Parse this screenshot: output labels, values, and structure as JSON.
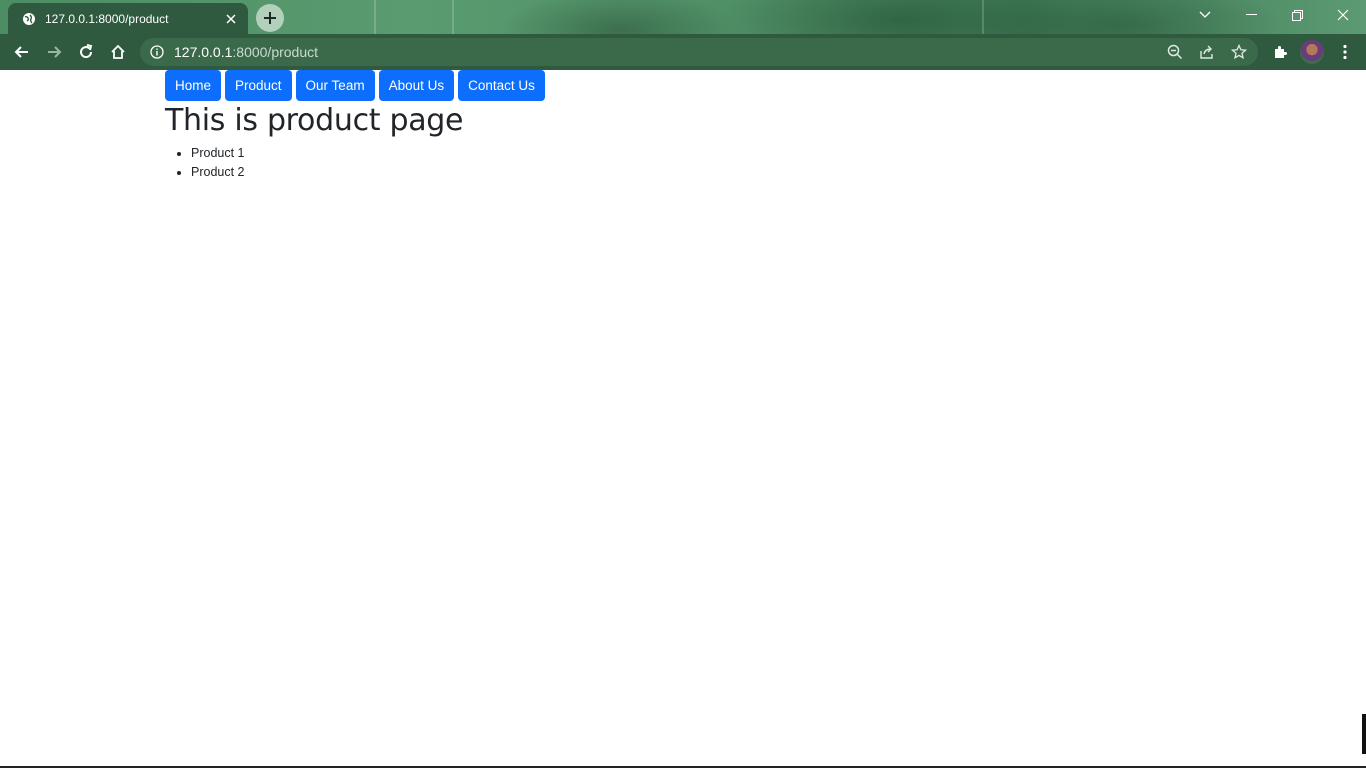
{
  "browser": {
    "tab": {
      "title": "127.0.0.1:8000/product",
      "favicon": "globe-icon",
      "close_icon": "close-icon"
    },
    "new_tab_icon": "plus-icon",
    "window_controls": [
      "tab-search-icon",
      "minimize-icon",
      "restore-icon",
      "close-icon"
    ],
    "toolbar": {
      "back_icon": "back-arrow-icon",
      "forward_icon": "forward-arrow-icon",
      "reload_icon": "reload-icon",
      "home_icon": "home-icon",
      "address": {
        "host": "127.0.0.1",
        "path": ":8000/product",
        "info_icon": "info-icon"
      },
      "zoom_icon": "zoom-out-icon",
      "share_icon": "share-icon",
      "bookmark_icon": "star-icon",
      "extensions_icon": "puzzle-icon",
      "profile_icon": "avatar",
      "menu_icon": "kebab-menu-icon"
    }
  },
  "nav": {
    "items": [
      {
        "label": "Home"
      },
      {
        "label": "Product"
      },
      {
        "label": "Our Team"
      },
      {
        "label": "About Us"
      },
      {
        "label": "Contact Us"
      }
    ]
  },
  "page": {
    "title": "This is product page",
    "products": [
      "Product 1",
      "Product 2"
    ]
  },
  "colors": {
    "button_bg": "#0d6efd",
    "button_text": "#ffffff",
    "text": "#212529",
    "chrome_dark": "#2f5a3f"
  }
}
